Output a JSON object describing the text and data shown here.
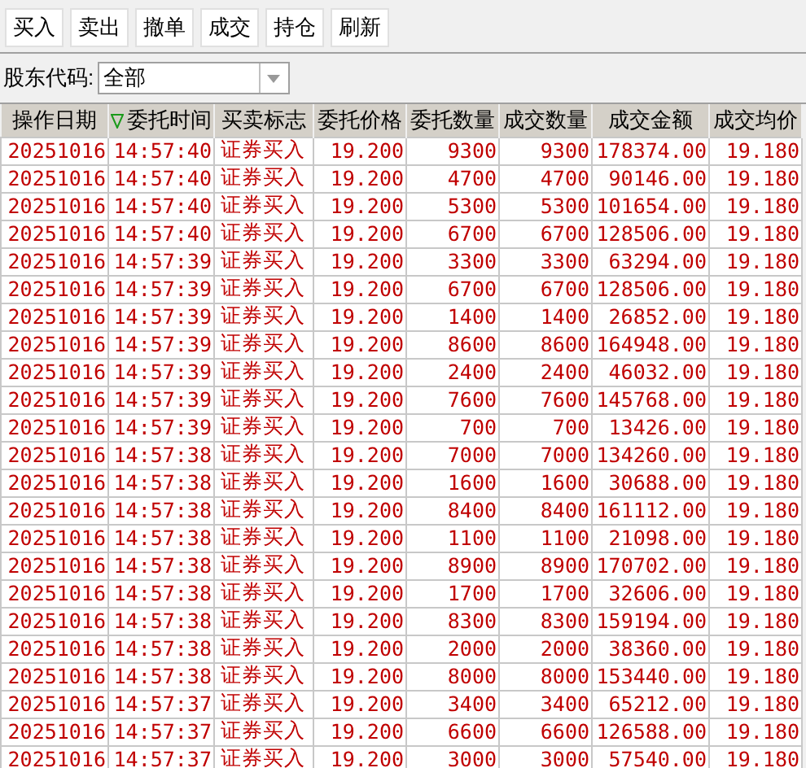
{
  "toolbar": {
    "buttons": [
      "买入",
      "卖出",
      "撤单",
      "成交",
      "持仓",
      "刷新"
    ]
  },
  "filter": {
    "label": "股东代码:",
    "value": "全部"
  },
  "table": {
    "columns": [
      {
        "label": "操作日期",
        "sorted": false
      },
      {
        "label": "委托时间",
        "sorted": true
      },
      {
        "label": "买卖标志",
        "sorted": false
      },
      {
        "label": "委托价格",
        "sorted": false
      },
      {
        "label": "委托数量",
        "sorted": false
      },
      {
        "label": "成交数量",
        "sorted": false
      },
      {
        "label": "成交金额",
        "sorted": false
      },
      {
        "label": "成交均价",
        "sorted": false
      }
    ],
    "rows": [
      [
        "20251016",
        "14:57:40",
        "证券买入",
        "19.200",
        "9300",
        "9300",
        "178374.00",
        "19.180"
      ],
      [
        "20251016",
        "14:57:40",
        "证券买入",
        "19.200",
        "4700",
        "4700",
        "90146.00",
        "19.180"
      ],
      [
        "20251016",
        "14:57:40",
        "证券买入",
        "19.200",
        "5300",
        "5300",
        "101654.00",
        "19.180"
      ],
      [
        "20251016",
        "14:57:40",
        "证券买入",
        "19.200",
        "6700",
        "6700",
        "128506.00",
        "19.180"
      ],
      [
        "20251016",
        "14:57:39",
        "证券买入",
        "19.200",
        "3300",
        "3300",
        "63294.00",
        "19.180"
      ],
      [
        "20251016",
        "14:57:39",
        "证券买入",
        "19.200",
        "6700",
        "6700",
        "128506.00",
        "19.180"
      ],
      [
        "20251016",
        "14:57:39",
        "证券买入",
        "19.200",
        "1400",
        "1400",
        "26852.00",
        "19.180"
      ],
      [
        "20251016",
        "14:57:39",
        "证券买入",
        "19.200",
        "8600",
        "8600",
        "164948.00",
        "19.180"
      ],
      [
        "20251016",
        "14:57:39",
        "证券买入",
        "19.200",
        "2400",
        "2400",
        "46032.00",
        "19.180"
      ],
      [
        "20251016",
        "14:57:39",
        "证券买入",
        "19.200",
        "7600",
        "7600",
        "145768.00",
        "19.180"
      ],
      [
        "20251016",
        "14:57:39",
        "证券买入",
        "19.200",
        "700",
        "700",
        "13426.00",
        "19.180"
      ],
      [
        "20251016",
        "14:57:38",
        "证券买入",
        "19.200",
        "7000",
        "7000",
        "134260.00",
        "19.180"
      ],
      [
        "20251016",
        "14:57:38",
        "证券买入",
        "19.200",
        "1600",
        "1600",
        "30688.00",
        "19.180"
      ],
      [
        "20251016",
        "14:57:38",
        "证券买入",
        "19.200",
        "8400",
        "8400",
        "161112.00",
        "19.180"
      ],
      [
        "20251016",
        "14:57:38",
        "证券买入",
        "19.200",
        "1100",
        "1100",
        "21098.00",
        "19.180"
      ],
      [
        "20251016",
        "14:57:38",
        "证券买入",
        "19.200",
        "8900",
        "8900",
        "170702.00",
        "19.180"
      ],
      [
        "20251016",
        "14:57:38",
        "证券买入",
        "19.200",
        "1700",
        "1700",
        "32606.00",
        "19.180"
      ],
      [
        "20251016",
        "14:57:38",
        "证券买入",
        "19.200",
        "8300",
        "8300",
        "159194.00",
        "19.180"
      ],
      [
        "20251016",
        "14:57:38",
        "证券买入",
        "19.200",
        "2000",
        "2000",
        "38360.00",
        "19.180"
      ],
      [
        "20251016",
        "14:57:38",
        "证券买入",
        "19.200",
        "8000",
        "8000",
        "153440.00",
        "19.180"
      ],
      [
        "20251016",
        "14:57:37",
        "证券买入",
        "19.200",
        "3400",
        "3400",
        "65212.00",
        "19.180"
      ],
      [
        "20251016",
        "14:57:37",
        "证券买入",
        "19.200",
        "6600",
        "6600",
        "126588.00",
        "19.180"
      ],
      [
        "20251016",
        "14:57:37",
        "证券买入",
        "19.200",
        "3000",
        "3000",
        "57540.00",
        "19.180"
      ]
    ]
  }
}
